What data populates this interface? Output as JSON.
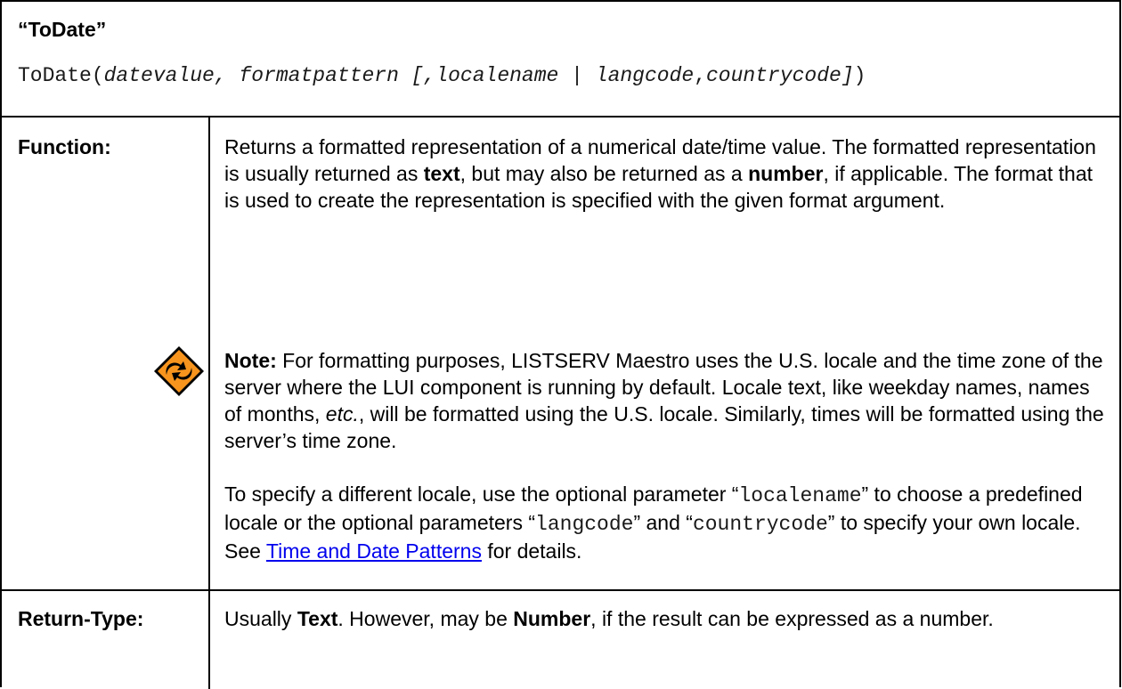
{
  "title": "“ToDate”",
  "signature": {
    "func": "ToDate(",
    "arg1": "datevalue",
    "sep1": ", ",
    "arg2": "formatpattern [,",
    "arg3": "localename",
    "sep2": " | ",
    "arg4": "langcode",
    "sep3": ",",
    "arg5": "countrycode]",
    "close": ")"
  },
  "function": {
    "label": "Function:",
    "desc_part1": "Returns a formatted representation of a numerical date/time value. The formatted representation is usually returned as ",
    "desc_bold1": "text",
    "desc_part2": ", but may also be returned as a ",
    "desc_bold2": "number",
    "desc_part3": ", if applicable. The format that is used to create the representation is specified with the given format argument.",
    "note_label": "Note:",
    "note_part1": " For formatting purposes, LISTSERV Maestro uses the U.S. locale and the time zone of the server where the LUI component is running by default. Locale text, like weekday names, names of months, ",
    "note_italic": "etc.",
    "note_part2": ", will be formatted using the U.S. locale. Similarly, times will be formatted using the server’s time zone.",
    "locale_part1": "To specify a different locale, use the optional parameter “",
    "locale_code1": "localename",
    "locale_part2": "” to choose a predefined locale or the optional parameters “",
    "locale_code2": "langcode",
    "locale_part3": "” and “",
    "locale_code3": "countrycode",
    "locale_part4": "” to specify your own locale. See ",
    "locale_link": "Time and Date Patterns",
    "locale_part5": " for details."
  },
  "return_type": {
    "label": "Return-Type:",
    "part1": "Usually ",
    "bold1": "Text",
    "part2": ". However, may be ",
    "bold2": "Number",
    "part3": ", if the result can be expressed as a number."
  },
  "colors": {
    "link": "#0000ee",
    "icon_fill": "#f7941d",
    "border": "#000000"
  },
  "icons": {
    "note": "note-caution-icon"
  }
}
